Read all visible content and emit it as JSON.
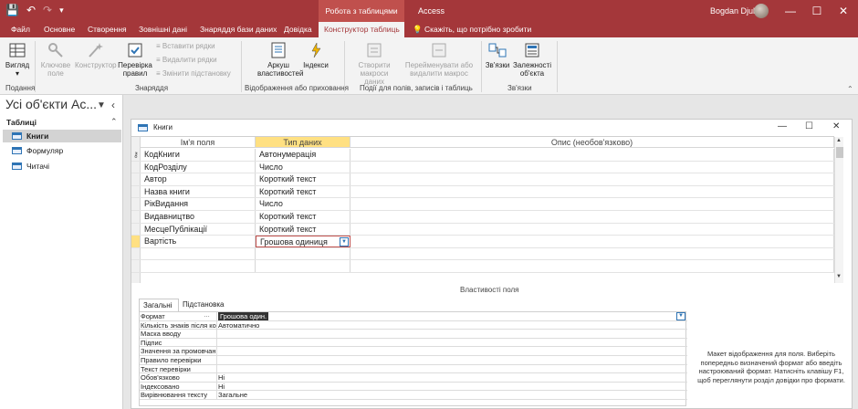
{
  "window": {
    "context_header": "Робота з таблицями",
    "app_name": "Access",
    "user_name": "Bogdan Djuk",
    "controls": {
      "minimize": "—",
      "maximize": "☐",
      "close": "✕"
    }
  },
  "ribbon_tabs": [
    {
      "label": "Файл"
    },
    {
      "label": "Основне"
    },
    {
      "label": "Створення"
    },
    {
      "label": "Зовнішні дані"
    },
    {
      "label": "Знаряддя бази даних"
    },
    {
      "label": "Довідка"
    },
    {
      "label": "Конструктор таблиць"
    }
  ],
  "tell_me": "Скажіть, що потрібно зробити",
  "ribbon": {
    "view": "Вигляд",
    "key_field": "Ключове поле",
    "builder": "Конструктор",
    "validate": "Перевірка правил",
    "insert_rows": "Вставити рядки",
    "delete_rows": "Видалити рядки",
    "modify_lookups": "Змінити підстановку",
    "property_sheet": "Аркуш властивостей",
    "indexes": "Індекси",
    "create_macros": "Створити макроси даних",
    "rename_macro": "Перейменувати або видалити макрос",
    "relationships": "Зв'язки",
    "object_dependencies": "Залежності об'єкта",
    "groups": {
      "views": "Подання",
      "tools": "Знаряддя",
      "show_hide": "Відображення або приховання",
      "field_events": "Події для полів, записів і таблиць",
      "relationships": "Зв'язки"
    }
  },
  "nav": {
    "title": "Усі об'єкти Ac...",
    "group": "Таблиці",
    "items": [
      {
        "label": "Книги"
      },
      {
        "label": "Формуляр"
      },
      {
        "label": "Читачі"
      }
    ]
  },
  "doc": {
    "title": "Книги",
    "headers": {
      "name": "Ім'я поля",
      "type": "Тип даних",
      "desc": "Опис (необов'язково)"
    },
    "fields": [
      {
        "name": "КодКниги",
        "type": "Автонумерація"
      },
      {
        "name": "КодРозділу",
        "type": "Число"
      },
      {
        "name": "Автор",
        "type": "Короткий текст"
      },
      {
        "name": "Назва книги",
        "type": "Короткий текст"
      },
      {
        "name": "РікВидання",
        "type": "Число"
      },
      {
        "name": "Видавництво",
        "type": "Короткий текст"
      },
      {
        "name": "МесцеПублікації",
        "type": "Короткий текст"
      },
      {
        "name": "Вартість",
        "type": "Грошова одиниця"
      }
    ]
  },
  "props": {
    "title": "Властивості поля",
    "tabs": [
      {
        "label": "Загальні"
      },
      {
        "label": "Підстановка"
      }
    ],
    "rows": [
      {
        "label": "Формат",
        "value": "Грошова один."
      },
      {
        "label": "Кількість знаків після ко",
        "value": "Автоматично"
      },
      {
        "label": "Маска вводу",
        "value": ""
      },
      {
        "label": "Підпис",
        "value": ""
      },
      {
        "label": "Значення за промовчанн",
        "value": ""
      },
      {
        "label": "Правило перевірки",
        "value": ""
      },
      {
        "label": "Текст перевірки",
        "value": ""
      },
      {
        "label": "Обов'язково",
        "value": "Ні"
      },
      {
        "label": "Індексовано",
        "value": "Ні"
      },
      {
        "label": "Вирівнювання тексту",
        "value": "Загальне"
      }
    ],
    "help": "Макет відображення для поля. Виберіть попередньо визначений формат або введіть настроюваний формат. Натисніть клавішу F1, щоб переглянути розділ довідки про формати."
  }
}
